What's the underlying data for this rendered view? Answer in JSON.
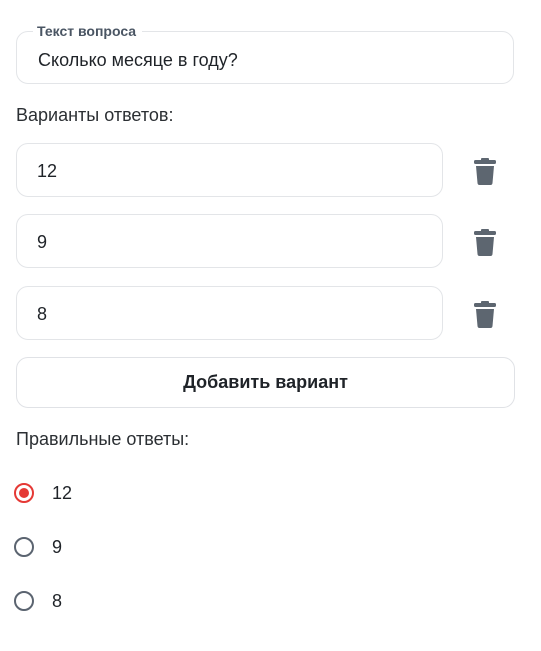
{
  "question": {
    "legend": "Текст вопроса",
    "value": "Сколько месяце в году?"
  },
  "options_section": {
    "label": "Варианты ответов:",
    "options": [
      "12",
      "9",
      "8"
    ],
    "delete_icon": "trash-icon"
  },
  "add_button": {
    "label": "Добавить вариант"
  },
  "correct_section": {
    "label": "Правильные ответы:",
    "radios": [
      {
        "label": "12",
        "checked": true
      },
      {
        "label": "9",
        "checked": false
      },
      {
        "label": "8",
        "checked": false
      }
    ],
    "accent_color": "#e53935"
  }
}
